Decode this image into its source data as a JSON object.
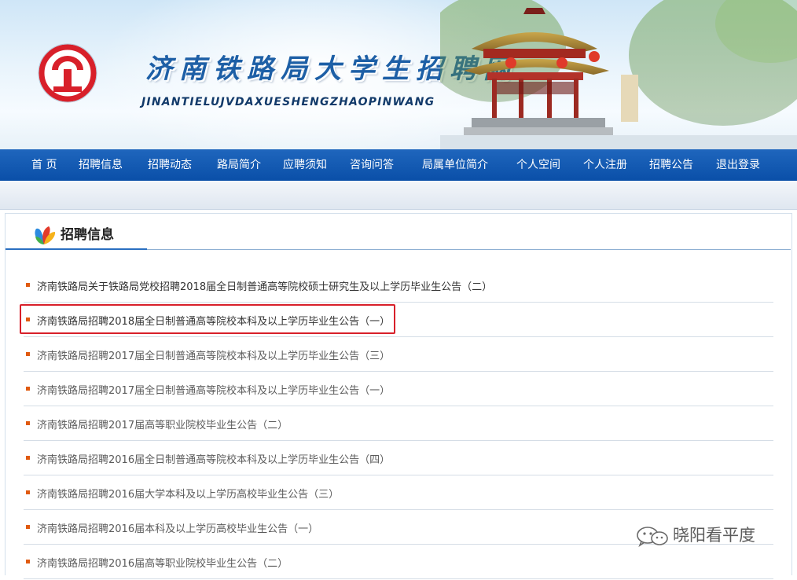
{
  "header": {
    "title": "济南铁路局大学生招聘网",
    "subtitle": "JINANTIELUJVDAXUESHENGZHAOPINWANG"
  },
  "nav": [
    {
      "label": "首 页"
    },
    {
      "label": "招聘信息"
    },
    {
      "label": "招聘动态"
    },
    {
      "label": "路局简介"
    },
    {
      "label": "应聘须知"
    },
    {
      "label": "咨询问答"
    },
    {
      "label": "局属单位简介"
    },
    {
      "label": "个人空间"
    },
    {
      "label": "个人注册"
    },
    {
      "label": "招聘公告"
    },
    {
      "label": "退出登录"
    }
  ],
  "section": {
    "title": "招聘信息"
  },
  "news": [
    {
      "title": "济南铁路局关于铁路局党校招聘2018届全日制普通高等院校硕士研究生及以上学历毕业生公告（二）"
    },
    {
      "title": "济南铁路局招聘2018届全日制普通高等院校本科及以上学历毕业生公告（一）"
    },
    {
      "title": "济南铁路局招聘2017届全日制普通高等院校本科及以上学历毕业生公告（三）"
    },
    {
      "title": "济南铁路局招聘2017届全日制普通高等院校本科及以上学历毕业生公告（一）"
    },
    {
      "title": "济南铁路局招聘2017届高等职业院校毕业生公告（二）"
    },
    {
      "title": "济南铁路局招聘2016届全日制普通高等院校本科及以上学历毕业生公告（四）"
    },
    {
      "title": "济南铁路局招聘2016届大学本科及以上学历高校毕业生公告（三）"
    },
    {
      "title": "济南铁路局招聘2016届本科及以上学历高校毕业生公告（一）"
    },
    {
      "title": "济南铁路局招聘2016届高等职业院校毕业生公告（二）"
    }
  ],
  "watermark": {
    "text": "晓阳看平度",
    "icon": "wechat-icon"
  },
  "colors": {
    "nav_bg": "#0d52aa",
    "accent_red": "#d8202a",
    "bullet": "#e05a10",
    "title_blue": "#1d5fa6"
  }
}
